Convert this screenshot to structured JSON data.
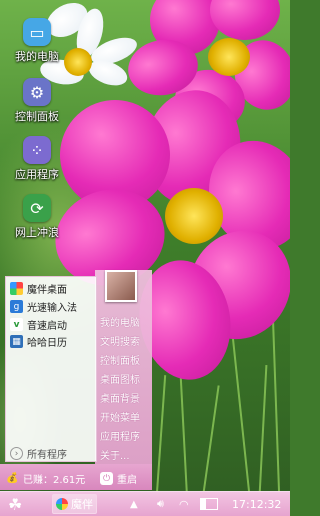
{
  "desktop": {
    "icons": [
      {
        "label": "我的电脑",
        "icon": "monitor-icon",
        "color": "#46a7e6"
      },
      {
        "label": "控制面板",
        "icon": "control-panel-icon",
        "color": "#6a74c8"
      },
      {
        "label": "应用程序",
        "icon": "apps-icon",
        "color": "#7c6bd0"
      },
      {
        "label": "网上冲浪",
        "icon": "browser-icon",
        "color": "#3aa14a"
      }
    ]
  },
  "start_menu": {
    "left_items": [
      {
        "label": "魔伴桌面",
        "icon": "pinwheel-icon"
      },
      {
        "label": "光速输入法",
        "icon": "input-method-icon"
      },
      {
        "label": "音速启动",
        "icon": "launcher-icon"
      },
      {
        "label": "哈哈日历",
        "icon": "calendar-icon"
      }
    ],
    "all_programs": "所有程序",
    "right_items": [
      "我的电脑",
      "文明搜索",
      "控制面板",
      "桌面图标",
      "桌面背景",
      "开始菜单",
      "应用程序",
      "关于..."
    ],
    "earned": "已赚：2.61元",
    "restart": "重启"
  },
  "taskbar": {
    "task_label": "魔伴",
    "clock": "17:12:32"
  },
  "colors": {
    "taskbar_pink": "#e6a4cf",
    "menu_pink": "#e4a0cd",
    "flower_magenta": "#e52bb6"
  }
}
